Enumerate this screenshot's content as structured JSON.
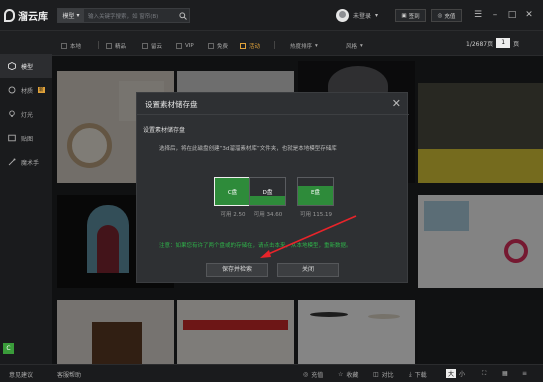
{
  "app": {
    "name": "溜云库"
  },
  "search": {
    "category": "模型",
    "placeholder": "输入关键字搜索，如 窗帘(B)"
  },
  "user": {
    "name": "未登录"
  },
  "titlebar": {
    "signin_label": "签到",
    "recharge_label": "充值",
    "window_controls": [
      "☰",
      "–",
      "□",
      "✕"
    ]
  },
  "filters": [
    {
      "label": "本地",
      "checked": false
    },
    {
      "label": "精品",
      "checked": false
    },
    {
      "label": "留云",
      "checked": false
    },
    {
      "label": "VIP",
      "checked": false
    },
    {
      "label": "免费",
      "checked": false
    },
    {
      "label": "活动",
      "checked": true
    }
  ],
  "dropdowns": [
    {
      "label": "热度排序"
    },
    {
      "label": "风格"
    }
  ],
  "pager": {
    "info": "1/2687页",
    "current": "1",
    "suffix": "页"
  },
  "sidebar": {
    "items": [
      {
        "label": "模型",
        "icon": "cube-icon",
        "active": true
      },
      {
        "label": "材质",
        "icon": "material-icon",
        "active": false,
        "badge": "新"
      },
      {
        "label": "灯光",
        "icon": "bulb-icon",
        "active": false
      },
      {
        "label": "贴图",
        "icon": "image-icon",
        "active": false
      },
      {
        "label": "魔术手",
        "icon": "magic-hand-icon",
        "active": false
      }
    ],
    "bottom_icon": "C"
  },
  "status": {
    "feedback": "意见建议",
    "service": "客服帮助",
    "actions": [
      "充值",
      "收藏",
      "对比",
      "下载"
    ],
    "view": [
      "大",
      "小"
    ]
  },
  "modal": {
    "title": "设置素材储存盘",
    "subtitle": "设置素材储存盘",
    "description": "选择后，将在此磁盘创建“3d溜溜素材库”文件夹，也就是本地模型存储库",
    "disks": [
      {
        "label": "C盘",
        "free": "可用 2.50",
        "used_fraction": 1.0,
        "selected": true
      },
      {
        "label": "D盘",
        "free": "可用 34.60",
        "used_fraction": 0.35,
        "selected": false
      },
      {
        "label": "E盘",
        "free": "可用 115.19",
        "used_fraction": 0.7,
        "selected": false
      }
    ],
    "note": "注意：如果您有许了两个盘或的存储在，请点击本来，从本地模型，重新数据。",
    "save_label": "保存并检索",
    "close_label": "关闭"
  },
  "colors": {
    "accent": "#e0a23a",
    "green": "#2e8b3a",
    "note_green": "#2fb24a",
    "arrow": "#e8242a"
  }
}
